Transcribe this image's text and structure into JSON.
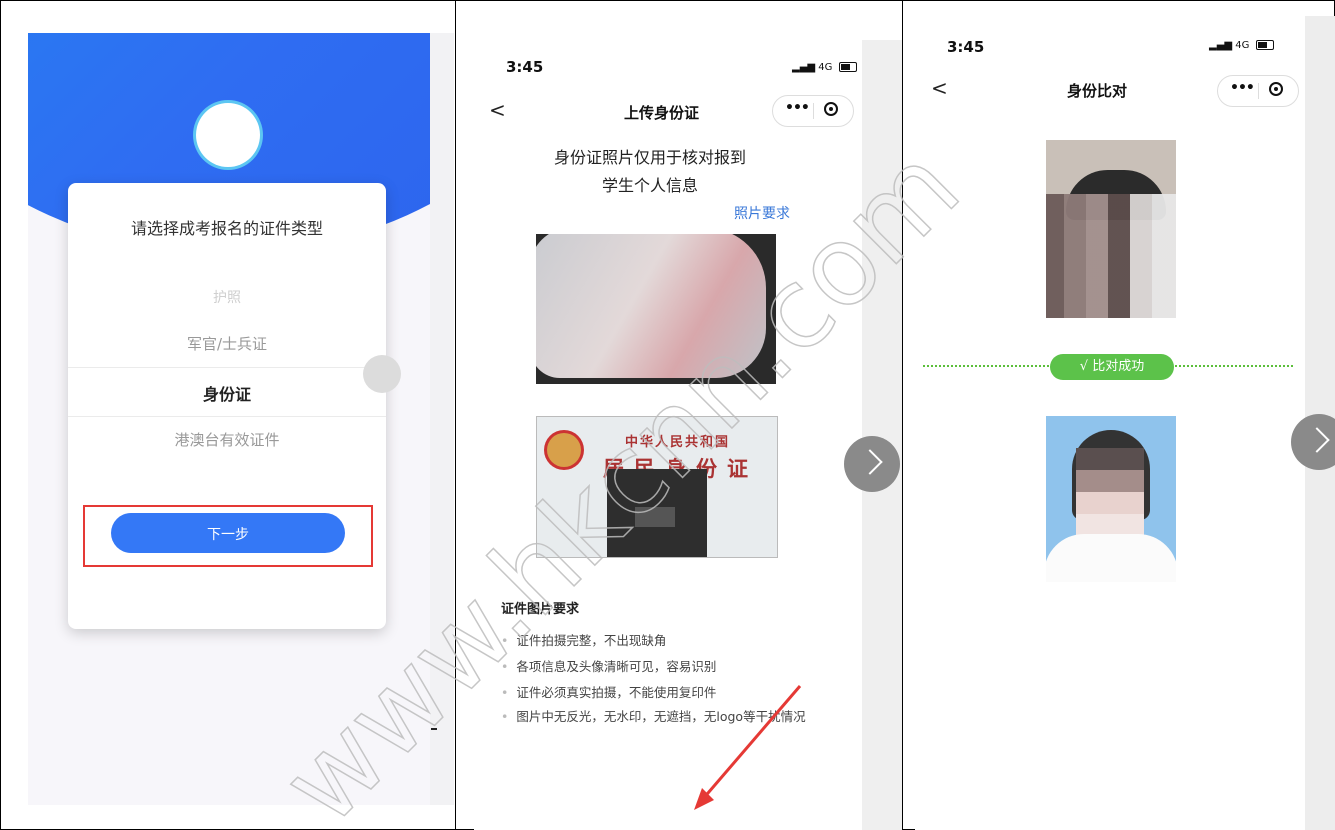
{
  "panel1": {
    "title": "请选择成考报名的证件类型",
    "options": [
      "护照",
      "军官/士兵证",
      "身份证",
      "港澳台有效证件"
    ],
    "next_button": "下一步"
  },
  "panel2": {
    "time": "3:45",
    "network": "4G",
    "back": "<",
    "nav_title": "上传身份证",
    "heading_line1": "身份证照片仅用于核对报到",
    "heading_line2": "学生个人信息",
    "photo_req_link": "照片要求",
    "id_back_title_small": "中华人民共和国",
    "id_back_title_big": "居民身份证",
    "requirements_title": "证件图片要求",
    "requirements": [
      "证件拍摄完整，不出现缺角",
      "各项信息及头像清晰可见，容易识别",
      "证件必须真实拍摄，不能使用复印件",
      "图片中无反光，无水印，无遮挡，无logo等干扰情况"
    ]
  },
  "panel3": {
    "time": "3:45",
    "network": "4G",
    "back": "<",
    "nav_title": "身份比对",
    "result_badge": "√ 比对成功"
  },
  "watermark": "www.hkcnn.com",
  "colors": {
    "primary_blue": "#3478f6",
    "success_green": "#5cc24a",
    "highlight_red": "#e53935",
    "link_blue": "#3a78d8"
  }
}
